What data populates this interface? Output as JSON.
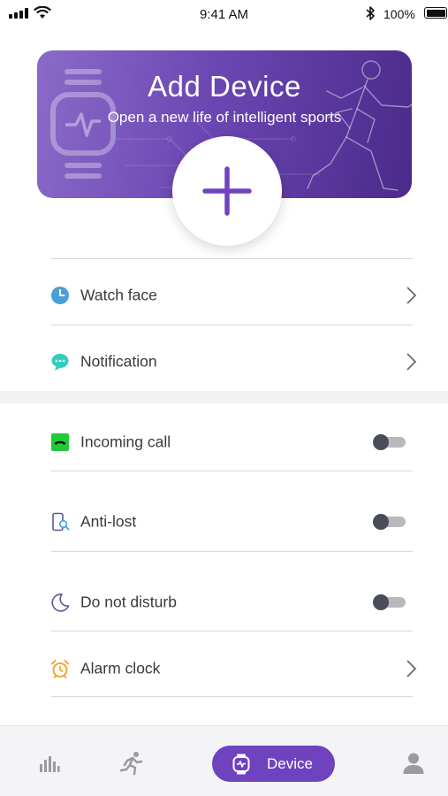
{
  "status_bar": {
    "time": "9:41 AM",
    "battery": "100%"
  },
  "banner": {
    "title": "Add Device",
    "subtitle": "Open a new life of intelligent sports"
  },
  "menu": {
    "watch_face": {
      "label": "Watch face",
      "icon": "clock-icon"
    },
    "notification": {
      "label": "Notification",
      "icon": "message-icon"
    }
  },
  "settings": {
    "incoming_call": {
      "label": "Incoming call",
      "icon": "phone-icon",
      "enabled": false
    },
    "anti_lost": {
      "label": "Anti-lost",
      "icon": "phone-search-icon",
      "enabled": false
    },
    "do_not_disturb": {
      "label": "Do not disturb",
      "icon": "moon-icon",
      "enabled": false
    },
    "alarm_clock": {
      "label": "Alarm clock",
      "icon": "alarm-clock-icon"
    }
  },
  "tab_bar": {
    "tabs": [
      {
        "name": "stats",
        "icon": "bar-chart-icon"
      },
      {
        "name": "sport",
        "icon": "runner-icon"
      },
      {
        "name": "device",
        "label": "Device",
        "icon": "watch-icon",
        "active": true
      },
      {
        "name": "profile",
        "icon": "person-icon"
      }
    ]
  },
  "colors": {
    "accent": "#6f43c0",
    "banner_start": "#8a6bc8",
    "banner_end": "#4a2a8a",
    "watch_face_icon": "#4a9fd8",
    "notification_icon": "#2fcfc0",
    "incoming_call_icon": "#22c93a",
    "alarm_icon": "#f0a020"
  }
}
